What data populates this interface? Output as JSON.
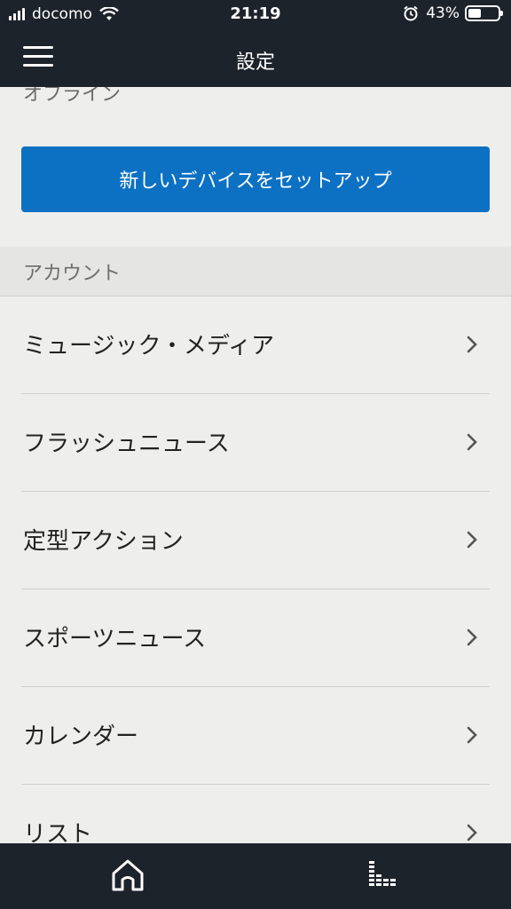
{
  "status": {
    "carrier": "docomo",
    "time": "21:19",
    "battery": "43%",
    "battery_level": 0.43,
    "icons": [
      "signal-icon",
      "wifi-icon",
      "alarm-icon",
      "battery-icon"
    ]
  },
  "header": {
    "title": "設定",
    "menu_icon": "hamburger-menu-icon"
  },
  "content": {
    "cutoff_label": "オフライン",
    "setup_button": "新しいデバイスをセットアップ",
    "section_title": "アカウント",
    "items": [
      {
        "label": "ミュージック・メディア"
      },
      {
        "label": "フラッシュニュース"
      },
      {
        "label": "定型アクション"
      },
      {
        "label": "スポーツニュース"
      },
      {
        "label": "カレンダー"
      },
      {
        "label": "リスト"
      }
    ]
  },
  "tabbar": {
    "tabs": [
      "home-icon",
      "activity-icon"
    ]
  },
  "colors": {
    "bar_bg": "#1d232b",
    "accent": "#0c71c3",
    "page_bg": "#eeeeed"
  }
}
